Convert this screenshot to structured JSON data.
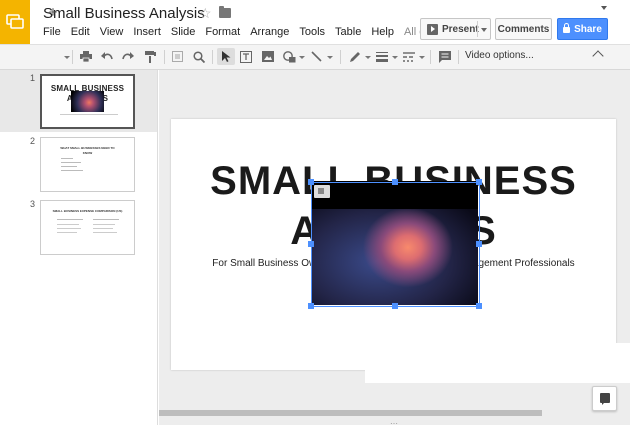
{
  "header": {
    "title": "Small Business Analysis",
    "present_label": "Present",
    "comments_label": "Comments",
    "share_label": "Share"
  },
  "menu": {
    "items": [
      "File",
      "Edit",
      "View",
      "Insert",
      "Slide",
      "Format",
      "Arrange",
      "Tools",
      "Table",
      "Help"
    ],
    "more": "All c..."
  },
  "toolbar": {
    "video_options_label": "Video options...",
    "icons": [
      "plus-icon",
      "print-icon",
      "undo-icon",
      "redo-icon",
      "paint-format-icon",
      "zoom-fit-icon",
      "zoom-icon",
      "select-cursor-icon",
      "textbox-icon",
      "image-icon",
      "shape-icon",
      "line-icon",
      "pen-icon",
      "line-weight-icon",
      "line-dash-icon",
      "comment-icon"
    ]
  },
  "filmstrip": {
    "slides": [
      {
        "number": "1",
        "title_line1": "SMALL BUSINESS",
        "title_line2": "ANALYSIS"
      },
      {
        "number": "2",
        "title_line1": "WHAT SMALL BUSINESSES NEED TO",
        "title_line2": "KNOW"
      },
      {
        "number": "3",
        "title_line1": "SMALL BUSINESS EXPENSE COMPARISON (US)",
        "title_line2": ""
      }
    ]
  },
  "slide": {
    "title_line1": "SMALL BUSINESS",
    "title_line2": "ANALYSIS",
    "subtitle": "For Small Business Owners, Managers, and Financial Management Professionals"
  },
  "colors": {
    "logo": "#f4b400",
    "accent": "#4d90fe",
    "canvas": "#ededed"
  }
}
